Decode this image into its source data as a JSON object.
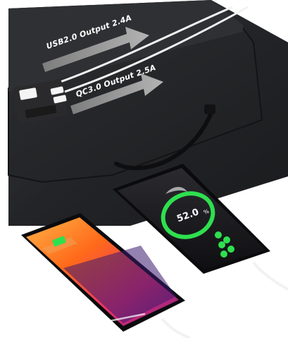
{
  "labels": {
    "usb": "USB2.0 Output 2.4A",
    "qc": "QC3.0 Output 2.5A"
  },
  "phone_right": {
    "battery_percent": "52.0",
    "unit": "%"
  },
  "colors": {
    "panel_dark": "#1c1c1e",
    "panel_fabric": "#26272a",
    "charge_green": "#2ee04f",
    "phone_left_screen": "#ff6a1a",
    "arrow_gray": "#9a9a9a"
  },
  "icons": [
    "usb-port-icon",
    "battery-icon",
    "arrow-icon"
  ]
}
